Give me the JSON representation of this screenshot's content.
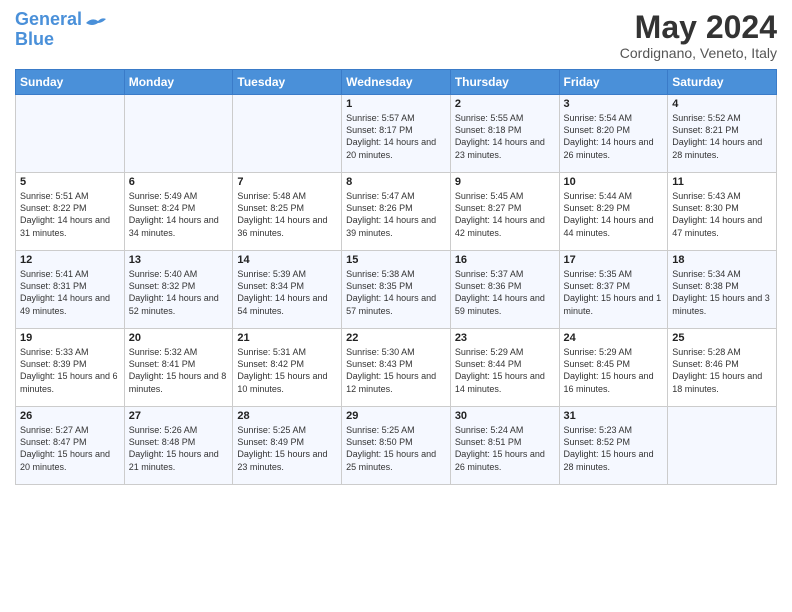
{
  "header": {
    "logo_line1": "General",
    "logo_line2": "Blue",
    "title": "May 2024",
    "subtitle": "Cordignano, Veneto, Italy"
  },
  "days_of_week": [
    "Sunday",
    "Monday",
    "Tuesday",
    "Wednesday",
    "Thursday",
    "Friday",
    "Saturday"
  ],
  "weeks": [
    [
      {
        "day": "",
        "info": ""
      },
      {
        "day": "",
        "info": ""
      },
      {
        "day": "",
        "info": ""
      },
      {
        "day": "1",
        "info": "Sunrise: 5:57 AM\nSunset: 8:17 PM\nDaylight: 14 hours\nand 20 minutes."
      },
      {
        "day": "2",
        "info": "Sunrise: 5:55 AM\nSunset: 8:18 PM\nDaylight: 14 hours\nand 23 minutes."
      },
      {
        "day": "3",
        "info": "Sunrise: 5:54 AM\nSunset: 8:20 PM\nDaylight: 14 hours\nand 26 minutes."
      },
      {
        "day": "4",
        "info": "Sunrise: 5:52 AM\nSunset: 8:21 PM\nDaylight: 14 hours\nand 28 minutes."
      }
    ],
    [
      {
        "day": "5",
        "info": "Sunrise: 5:51 AM\nSunset: 8:22 PM\nDaylight: 14 hours\nand 31 minutes."
      },
      {
        "day": "6",
        "info": "Sunrise: 5:49 AM\nSunset: 8:24 PM\nDaylight: 14 hours\nand 34 minutes."
      },
      {
        "day": "7",
        "info": "Sunrise: 5:48 AM\nSunset: 8:25 PM\nDaylight: 14 hours\nand 36 minutes."
      },
      {
        "day": "8",
        "info": "Sunrise: 5:47 AM\nSunset: 8:26 PM\nDaylight: 14 hours\nand 39 minutes."
      },
      {
        "day": "9",
        "info": "Sunrise: 5:45 AM\nSunset: 8:27 PM\nDaylight: 14 hours\nand 42 minutes."
      },
      {
        "day": "10",
        "info": "Sunrise: 5:44 AM\nSunset: 8:29 PM\nDaylight: 14 hours\nand 44 minutes."
      },
      {
        "day": "11",
        "info": "Sunrise: 5:43 AM\nSunset: 8:30 PM\nDaylight: 14 hours\nand 47 minutes."
      }
    ],
    [
      {
        "day": "12",
        "info": "Sunrise: 5:41 AM\nSunset: 8:31 PM\nDaylight: 14 hours\nand 49 minutes."
      },
      {
        "day": "13",
        "info": "Sunrise: 5:40 AM\nSunset: 8:32 PM\nDaylight: 14 hours\nand 52 minutes."
      },
      {
        "day": "14",
        "info": "Sunrise: 5:39 AM\nSunset: 8:34 PM\nDaylight: 14 hours\nand 54 minutes."
      },
      {
        "day": "15",
        "info": "Sunrise: 5:38 AM\nSunset: 8:35 PM\nDaylight: 14 hours\nand 57 minutes."
      },
      {
        "day": "16",
        "info": "Sunrise: 5:37 AM\nSunset: 8:36 PM\nDaylight: 14 hours\nand 59 minutes."
      },
      {
        "day": "17",
        "info": "Sunrise: 5:35 AM\nSunset: 8:37 PM\nDaylight: 15 hours\nand 1 minute."
      },
      {
        "day": "18",
        "info": "Sunrise: 5:34 AM\nSunset: 8:38 PM\nDaylight: 15 hours\nand 3 minutes."
      }
    ],
    [
      {
        "day": "19",
        "info": "Sunrise: 5:33 AM\nSunset: 8:39 PM\nDaylight: 15 hours\nand 6 minutes."
      },
      {
        "day": "20",
        "info": "Sunrise: 5:32 AM\nSunset: 8:41 PM\nDaylight: 15 hours\nand 8 minutes."
      },
      {
        "day": "21",
        "info": "Sunrise: 5:31 AM\nSunset: 8:42 PM\nDaylight: 15 hours\nand 10 minutes."
      },
      {
        "day": "22",
        "info": "Sunrise: 5:30 AM\nSunset: 8:43 PM\nDaylight: 15 hours\nand 12 minutes."
      },
      {
        "day": "23",
        "info": "Sunrise: 5:29 AM\nSunset: 8:44 PM\nDaylight: 15 hours\nand 14 minutes."
      },
      {
        "day": "24",
        "info": "Sunrise: 5:29 AM\nSunset: 8:45 PM\nDaylight: 15 hours\nand 16 minutes."
      },
      {
        "day": "25",
        "info": "Sunrise: 5:28 AM\nSunset: 8:46 PM\nDaylight: 15 hours\nand 18 minutes."
      }
    ],
    [
      {
        "day": "26",
        "info": "Sunrise: 5:27 AM\nSunset: 8:47 PM\nDaylight: 15 hours\nand 20 minutes."
      },
      {
        "day": "27",
        "info": "Sunrise: 5:26 AM\nSunset: 8:48 PM\nDaylight: 15 hours\nand 21 minutes."
      },
      {
        "day": "28",
        "info": "Sunrise: 5:25 AM\nSunset: 8:49 PM\nDaylight: 15 hours\nand 23 minutes."
      },
      {
        "day": "29",
        "info": "Sunrise: 5:25 AM\nSunset: 8:50 PM\nDaylight: 15 hours\nand 25 minutes."
      },
      {
        "day": "30",
        "info": "Sunrise: 5:24 AM\nSunset: 8:51 PM\nDaylight: 15 hours\nand 26 minutes."
      },
      {
        "day": "31",
        "info": "Sunrise: 5:23 AM\nSunset: 8:52 PM\nDaylight: 15 hours\nand 28 minutes."
      },
      {
        "day": "",
        "info": ""
      }
    ]
  ]
}
